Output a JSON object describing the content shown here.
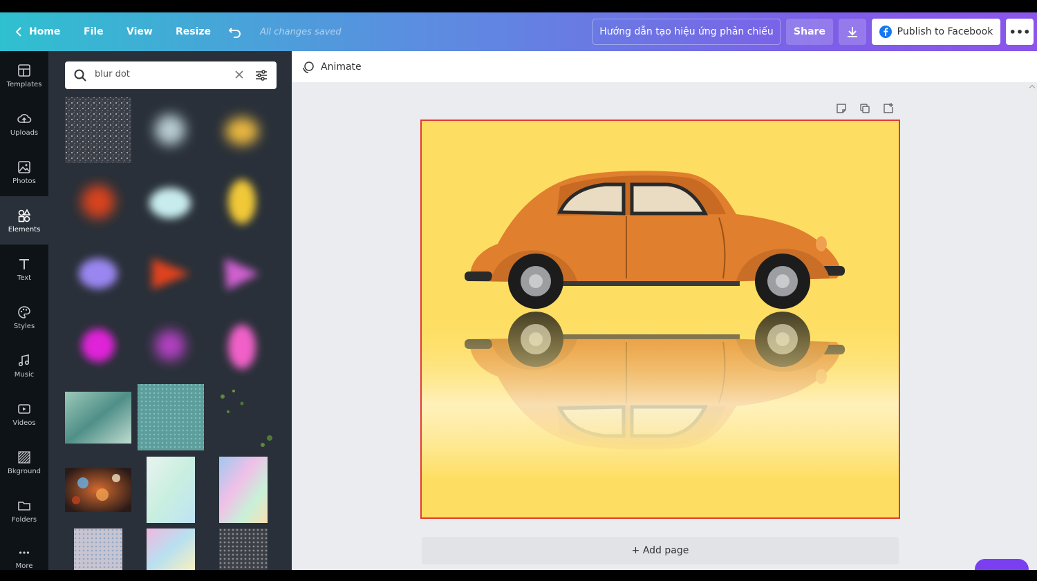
{
  "header": {
    "home_label": "Home",
    "file_label": "File",
    "view_label": "View",
    "resize_label": "Resize",
    "saved_status": "All changes saved",
    "design_title": "Hướng dẫn tạo hiệu ứng phản chiếu",
    "share_label": "Share",
    "publish_label": "Publish to Facebook",
    "more_label": "•••"
  },
  "sidebar": {
    "items": [
      {
        "label": "Templates",
        "icon": "templates-icon"
      },
      {
        "label": "Uploads",
        "icon": "upload-icon"
      },
      {
        "label": "Photos",
        "icon": "photo-icon"
      },
      {
        "label": "Elements",
        "icon": "elements-icon"
      },
      {
        "label": "Text",
        "icon": "text-icon"
      },
      {
        "label": "Styles",
        "icon": "palette-icon"
      },
      {
        "label": "Music",
        "icon": "music-icon"
      },
      {
        "label": "Videos",
        "icon": "video-icon"
      },
      {
        "label": "Bkground",
        "icon": "background-icon"
      },
      {
        "label": "Folders",
        "icon": "folder-icon"
      },
      {
        "label": "More",
        "icon": "more-icon"
      }
    ],
    "active": "Elements"
  },
  "panel": {
    "search_value": "blur dot"
  },
  "editor": {
    "animate_label": "Animate",
    "add_page_label": "+ Add page"
  },
  "colors": {
    "canvas_bg": "#fede62",
    "selection_border": "#e33a2e",
    "car_body": "#e07f2e",
    "header_gradient_start": "#2fc0cf",
    "header_gradient_end": "#8b55ea"
  }
}
